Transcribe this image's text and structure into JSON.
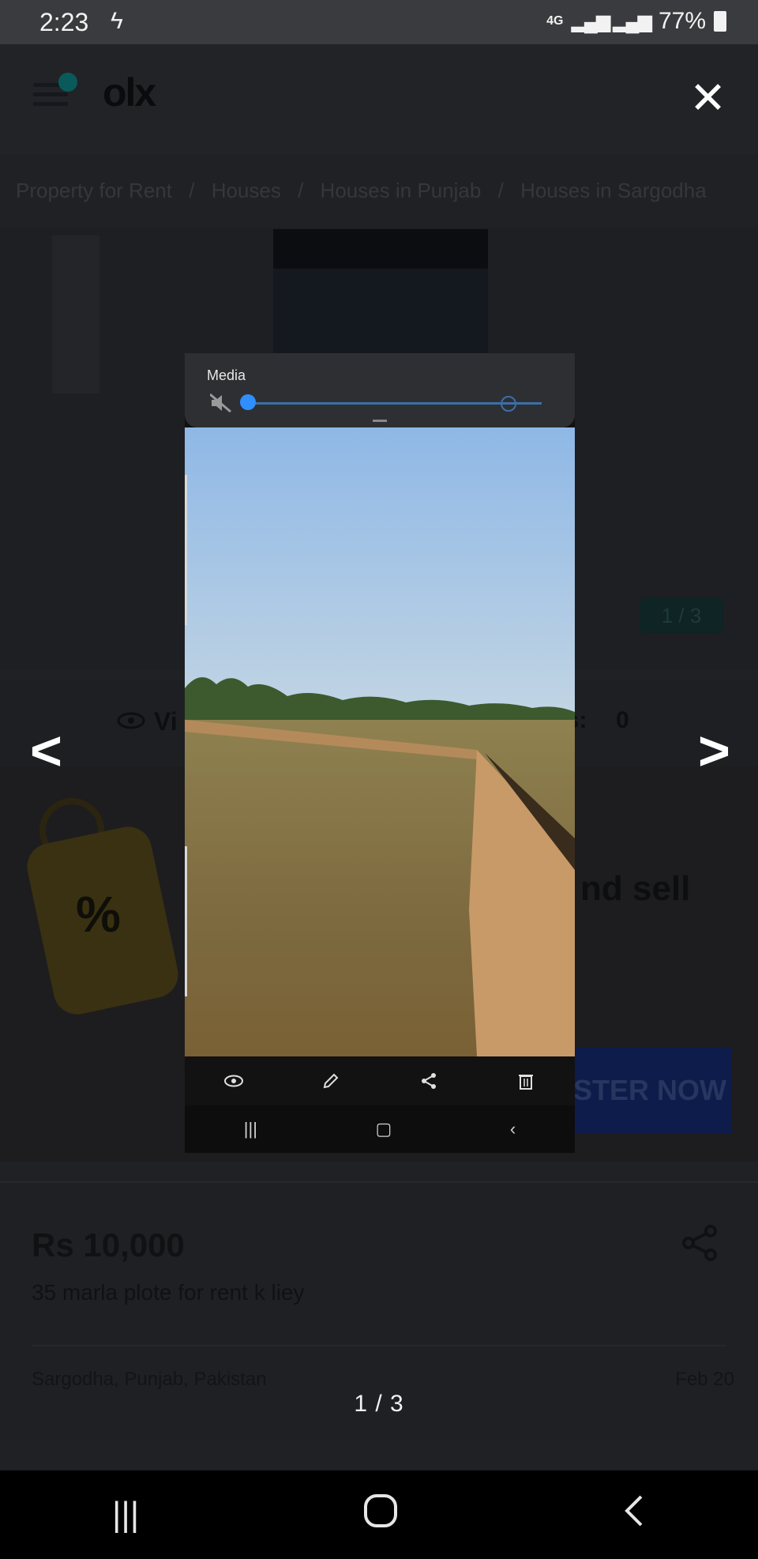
{
  "status_bar": {
    "time": "2:23",
    "charging_icon": "bolt-icon",
    "network": "4G",
    "battery": "77%"
  },
  "header": {
    "brand": "olx",
    "close_icon": "close-icon"
  },
  "breadcrumb": [
    "Property for Rent",
    "/",
    "Houses",
    "/",
    "Houses in Punjab",
    "/",
    "Houses in Sargodha"
  ],
  "image_counter_badge": "1 / 3",
  "stats": {
    "views_label": "Vi",
    "favorites_label": "es:",
    "favorites_count": "0"
  },
  "promo": {
    "text": "nd sell",
    "button_label": "STER NOW",
    "icon": "discount-tag-icon"
  },
  "listing": {
    "price": "Rs 10,000",
    "title": "35 marla plote for rent k liey",
    "location": "Sargodha, Punjab, Pakistan",
    "date": "Feb 20"
  },
  "viewer": {
    "pager": "1 / 3",
    "prev_icon": "chevron-left-icon",
    "next_icon": "chevron-right-icon"
  },
  "embedded_screenshot": {
    "media_label": "Media",
    "volume_level": 0.0,
    "toolbar_icons": [
      "eye-icon",
      "pencil-icon",
      "share-icon",
      "trash-icon"
    ]
  },
  "colors": {
    "accent_blue": "#2f8fff",
    "overlay_bg": "#1b1c1e"
  }
}
